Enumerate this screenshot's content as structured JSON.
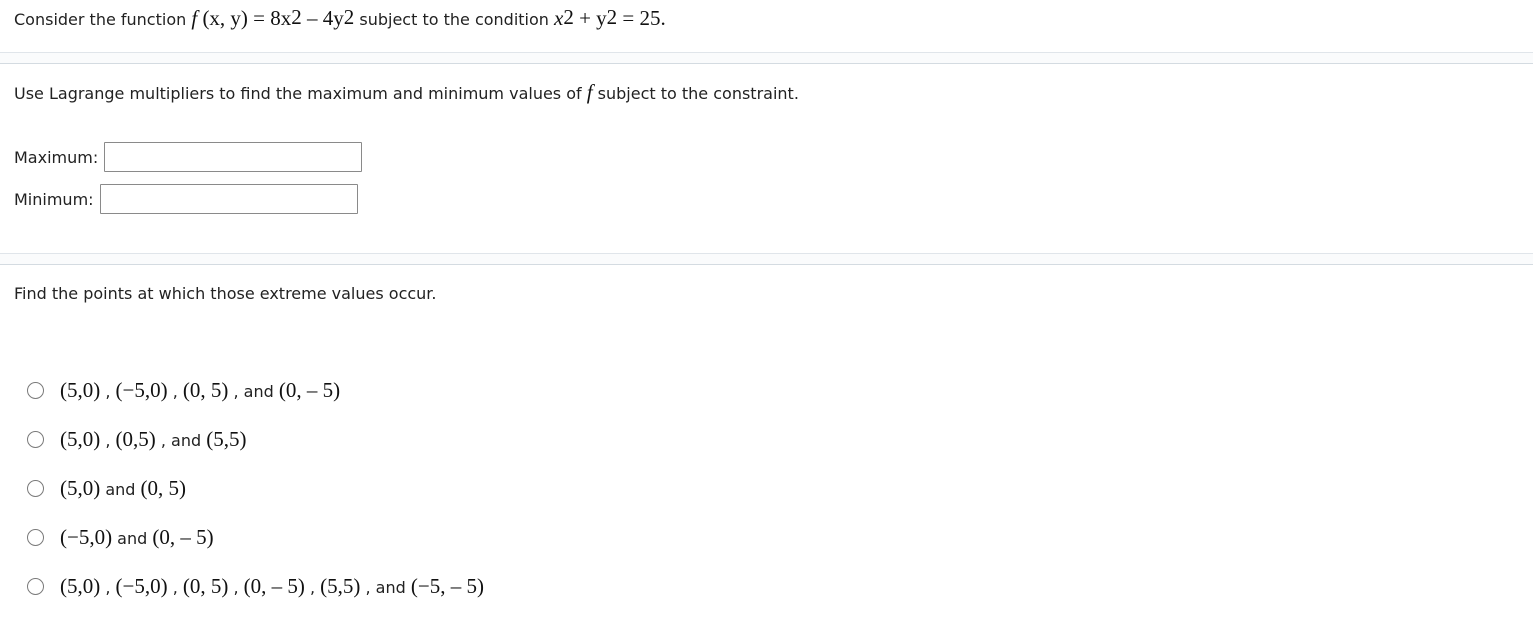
{
  "question": {
    "intro_text": "Consider the function ",
    "f_symbol": "f",
    "f_args": " (x, y) = 8x",
    "exp1": "2",
    "minus_term": " – 4y",
    "exp2": "2",
    "subject_text": " subject to the condition ",
    "constraint_x": "x",
    "exp3": "2",
    "constraint_plus": " + y",
    "exp4": "2",
    "constraint_end": " = 25."
  },
  "part1": {
    "prompt_text": "Use Lagrange multipliers to find the maximum and minimum values of ",
    "f_symbol": "f",
    "prompt_tail": " subject to the constraint.",
    "maximum_label": "Maximum:",
    "maximum_value": "",
    "minimum_label": "Minimum:",
    "minimum_value": ""
  },
  "part2": {
    "prompt_text": "Find the points at which those extreme values occur.",
    "options": [
      {
        "selected": false,
        "segments": [
          {
            "kind": "math",
            "text": "(5,0)"
          },
          {
            "kind": "text",
            "text": " , "
          },
          {
            "kind": "math",
            "text": "(−5,0)"
          },
          {
            "kind": "text",
            "text": " , "
          },
          {
            "kind": "math",
            "text": "(0, 5)"
          },
          {
            "kind": "text",
            "text": " , and "
          },
          {
            "kind": "math",
            "text": "(0, – 5)"
          }
        ]
      },
      {
        "selected": false,
        "segments": [
          {
            "kind": "math",
            "text": "(5,0)"
          },
          {
            "kind": "text",
            "text": " , "
          },
          {
            "kind": "math",
            "text": "(0,5)"
          },
          {
            "kind": "text",
            "text": " , and "
          },
          {
            "kind": "math",
            "text": "(5,5)"
          }
        ]
      },
      {
        "selected": false,
        "segments": [
          {
            "kind": "math",
            "text": "(5,0)"
          },
          {
            "kind": "text",
            "text": " and "
          },
          {
            "kind": "math",
            "text": "(0, 5)"
          }
        ]
      },
      {
        "selected": false,
        "segments": [
          {
            "kind": "math",
            "text": "(−5,0)"
          },
          {
            "kind": "text",
            "text": " and "
          },
          {
            "kind": "math",
            "text": "(0, – 5)"
          }
        ]
      },
      {
        "selected": false,
        "segments": [
          {
            "kind": "math",
            "text": "(5,0)"
          },
          {
            "kind": "text",
            "text": " , "
          },
          {
            "kind": "math",
            "text": "(−5,0)"
          },
          {
            "kind": "text",
            "text": " , "
          },
          {
            "kind": "math",
            "text": "(0, 5)"
          },
          {
            "kind": "text",
            "text": " , "
          },
          {
            "kind": "math",
            "text": "(0, – 5)"
          },
          {
            "kind": "text",
            "text": " , "
          },
          {
            "kind": "math",
            "text": "(5,5)"
          },
          {
            "kind": "text",
            "text": " , and "
          },
          {
            "kind": "math",
            "text": "(−5, – 5)"
          }
        ]
      }
    ]
  },
  "colors": {
    "border_input": "#8a8a8a",
    "divider": "#d6dde3",
    "text": "#222222"
  }
}
